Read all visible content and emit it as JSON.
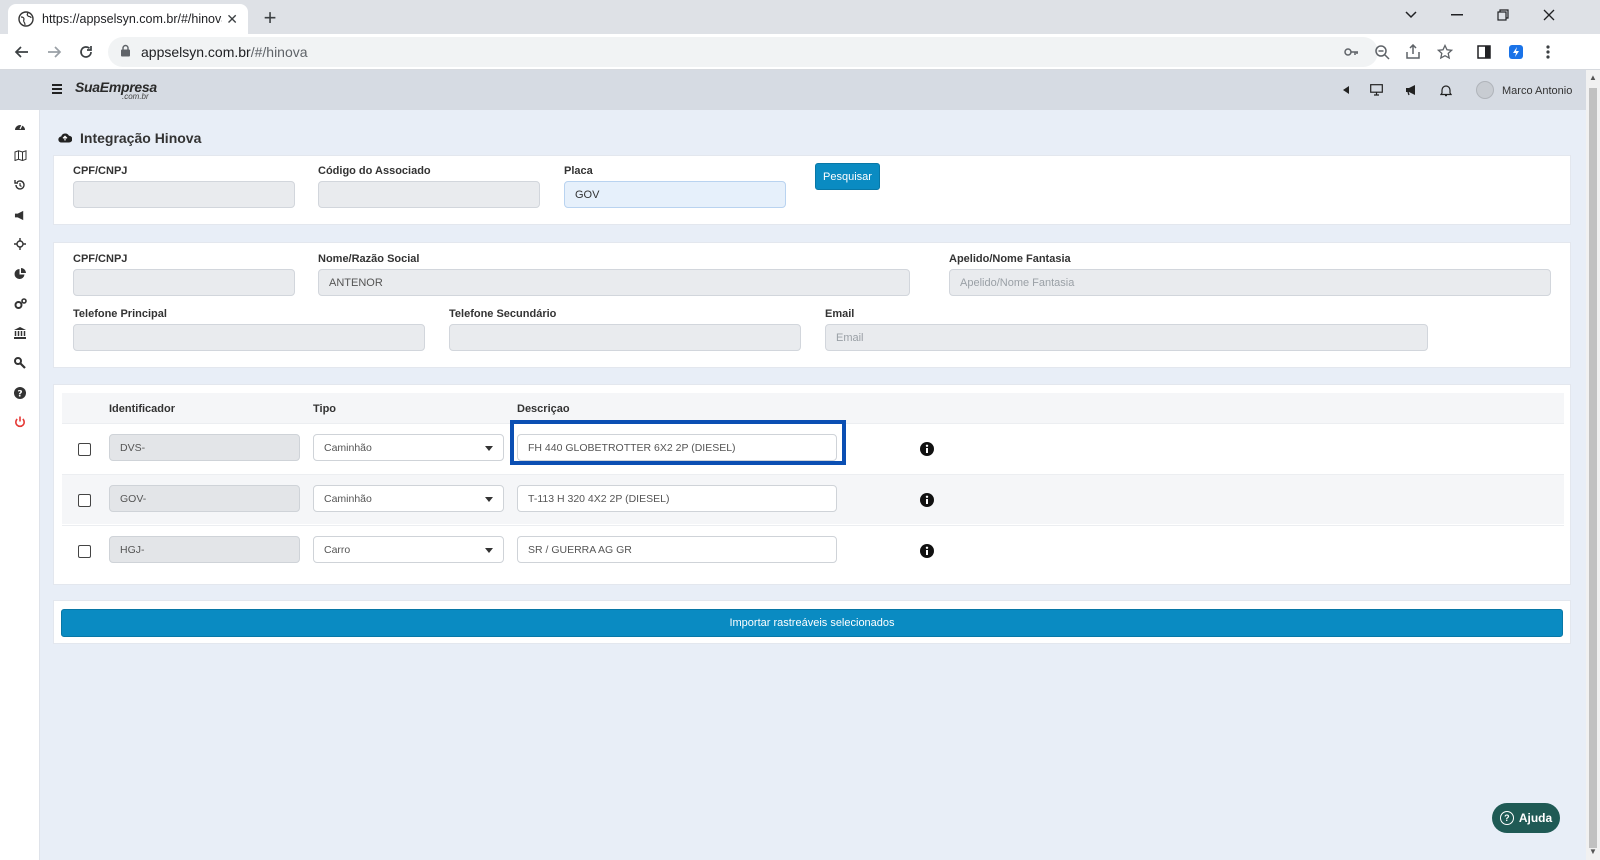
{
  "browser": {
    "tab_title": "https://appselsyn.com.br/#/hinova",
    "url_host": "appselsyn.com.br",
    "url_path": "/#/hinova"
  },
  "app": {
    "logo_main": "SuaEmpresa",
    "logo_sub": ".com.br",
    "user_name": "Marco Antonio"
  },
  "page": {
    "title": "Integração Hinova"
  },
  "search": {
    "cpf_label": "CPF/CNPJ",
    "cpf_value": "",
    "codigo_label": "Código do Associado",
    "codigo_value": "",
    "placa_label": "Placa",
    "placa_value": "GOV",
    "button_label": "Pesquisar"
  },
  "associado": {
    "cpf_label": "CPF/CNPJ",
    "cpf_value": "",
    "nome_label": "Nome/Razão Social",
    "nome_value": "ANTENOR",
    "apelido_label": "Apelido/Nome Fantasia",
    "apelido_placeholder": "Apelido/Nome Fantasia",
    "tel_principal_label": "Telefone Principal",
    "tel_principal_value": "",
    "tel_secundario_label": "Telefone Secundário",
    "tel_secundario_value": "",
    "email_label": "Email",
    "email_placeholder": "Email"
  },
  "grid": {
    "headers": {
      "identificador": "Identificador",
      "tipo": "Tipo",
      "descricao": "Descriçao"
    },
    "rows": [
      {
        "identificador": "DVS-",
        "tipo": "Caminhão",
        "descricao": "FH 440 GLOBETROTTER 6X2 2P (DIESEL)",
        "checked": false
      },
      {
        "identificador": "GOV-",
        "tipo": "Caminhão",
        "descricao": "T-113 H 320 4X2 2P (DIESEL)",
        "checked": false
      },
      {
        "identificador": "HGJ-",
        "tipo": "Carro",
        "descricao": "SR / GUERRA AG GR",
        "checked": false
      }
    ]
  },
  "import_button": "Importar rastreáveis selecionados",
  "help_button": "Ajuda",
  "colors": {
    "primary": "#0a8bc2",
    "highlight": "#0b4fb3",
    "help": "#1f5a55",
    "power": "#e53935"
  }
}
